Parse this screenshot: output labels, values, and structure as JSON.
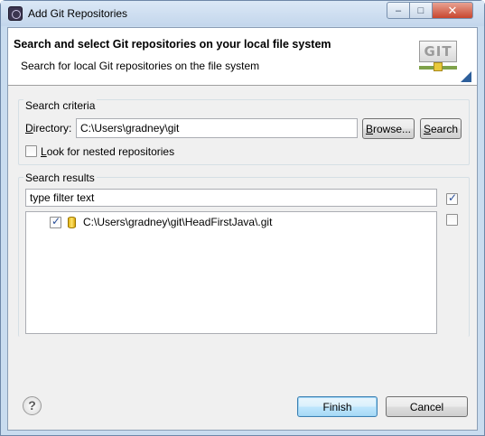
{
  "window": {
    "title": "Add Git Repositories",
    "close_glyph": "✕",
    "max_glyph": "□",
    "min_glyph": "–"
  },
  "header": {
    "title": "Search and select Git repositories on your local file system",
    "description": "Search for local Git repositories on the file system",
    "logo_text": "GIT"
  },
  "search_criteria": {
    "group_label": "Search criteria",
    "directory_label": "Directory:",
    "directory_value": "C:\\Users\\gradney\\git",
    "browse_label": "Browse...",
    "search_label": "Search",
    "nested_label": "Look for nested repositories",
    "nested_checked": false
  },
  "search_results": {
    "group_label": "Search results",
    "filter_value": "type filter text",
    "items": [
      {
        "label": "C:\\Users\\gradney\\git\\HeadFirstJava\\.git",
        "checked": true,
        "icon": "git-repository-icon"
      }
    ],
    "select_all_checked": true,
    "deselect_all_checked": false
  },
  "footer": {
    "help_glyph": "?",
    "finish_label": "Finish",
    "cancel_label": "Cancel"
  }
}
